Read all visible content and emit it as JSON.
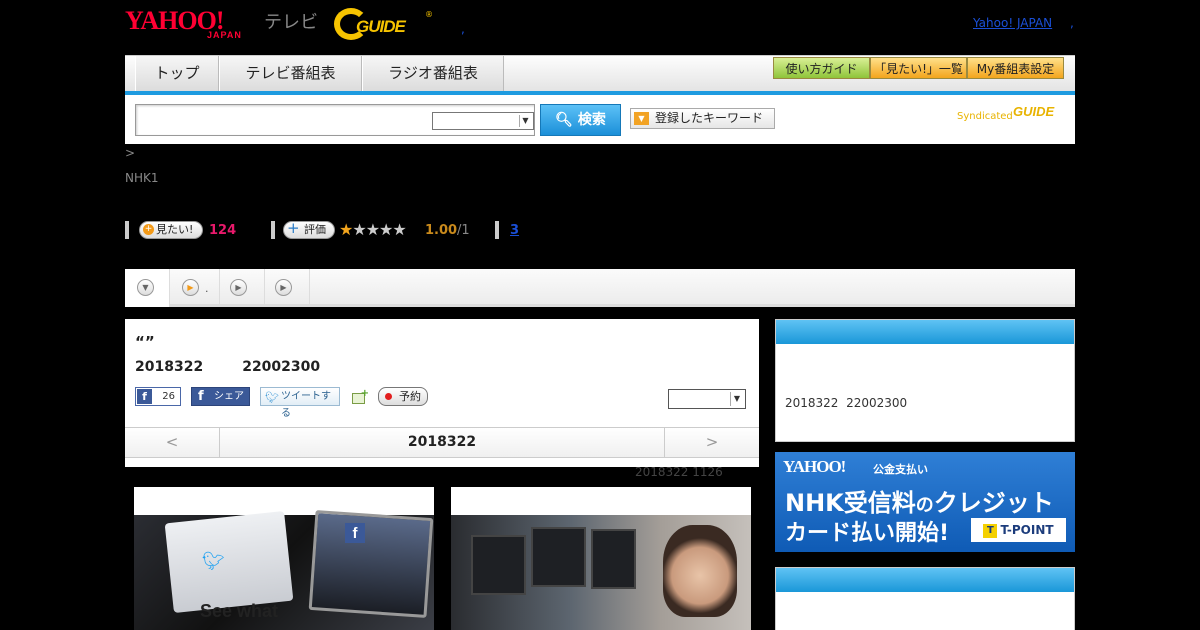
{
  "header": {
    "yahoo_logo": "YAHOO!",
    "yahoo_logo_sub": "JAPAN",
    "tv_label": "テレビ",
    "gguide_logo": "GUIDE",
    "gguide_reg": "®",
    "dot": ",",
    "yahoo_japan_link": "Yahoo! JAPAN",
    "yahoo_japan_sep": ","
  },
  "nav": {
    "tabs": [
      "トップ",
      "テレビ番組表",
      "ラジオ番組表"
    ],
    "sub_buttons": [
      "使い方ガイド",
      "「見たい!」一覧",
      "My番組表設定"
    ]
  },
  "search": {
    "placeholder": "",
    "select_value": "",
    "button_label": "検索",
    "keyword_button": "登録したキーワード",
    "syndicated": "Syndicated",
    "syndicated_logo": "GUIDE"
  },
  "breadcrumb": ">",
  "channel": "NHK1",
  "stats": {
    "want_label": "見たい!",
    "want_count": "124",
    "rate_label": "評価",
    "stars_total": 5,
    "stars_filled": 1,
    "rating": "1.00",
    "rating_count": "/1",
    "comments": "3"
  },
  "tabs_strip": {
    "dot": "."
  },
  "program": {
    "title": "“”",
    "date": "2018322",
    "time": "22002300",
    "fb_count": "26",
    "fb_share": "シェア",
    "tweet": "ツイートする",
    "reserve": "予約",
    "select_value": "",
    "pager_prev": "<",
    "pager_date": "2018322",
    "pager_next": ">",
    "updated": "2018322  1126"
  },
  "thumbnails": {
    "thumb1_caption": "See what"
  },
  "sidebar": {
    "box1_datetime": "2018322  22002300",
    "ad": {
      "logo": "YAHOO!",
      "logo_sub": "公金支払い",
      "line1_a": "NHK受信料",
      "line1_b": "の",
      "line1_c": "クレジット",
      "line2": "カード払い開始!",
      "tpoint": "T-POINT"
    }
  },
  "colors": {
    "accent_blue": "#1e9be0",
    "yahoo_red": "#ff0033",
    "gguide_yellow": "#f7c400",
    "want_pink": "#e8196b",
    "rating_gold": "#c98a1c"
  }
}
